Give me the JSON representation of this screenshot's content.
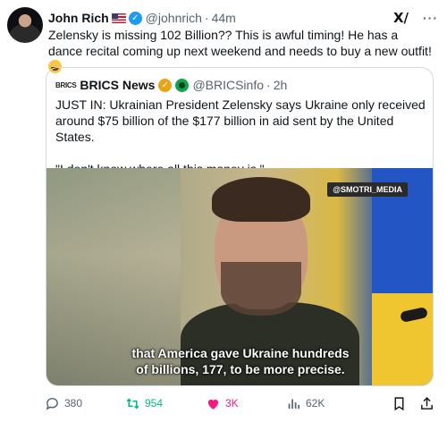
{
  "author": {
    "name": "John Rich",
    "handle": "@johnrich",
    "time": "44m",
    "separator": "·"
  },
  "header_icons": [
    "us-flag-icon",
    "verified-icon",
    "grok-icon",
    "more-icon"
  ],
  "tweet": {
    "text": "Zelensky is missing 102 Billion?? This is awful timing! He has a dance recital coming up next weekend and needs to buy a new outfit!"
  },
  "quote": {
    "logo_text": "BRICS",
    "name": "BRICS News",
    "handle": "@BRICSinfo",
    "time": "2h",
    "separator": "·",
    "paragraph_1": "JUST IN: Ukrainian President Zelensky says Ukraine only received around $75 billion of the $177 billion in aid sent by the United States.",
    "paragraph_2": "\"I don't know where all this money is.\"",
    "media": {
      "watermark": "@SMOTRI_MEDIA",
      "caption_line_1": "that America gave Ukraine hundreds",
      "caption_line_2": "of billions, 177, to be more precise."
    }
  },
  "actions": {
    "replies": "380",
    "reposts": "954",
    "likes": "3K",
    "views": "62K"
  },
  "colors": {
    "verified": "#1d9bf0",
    "repost": "#00ba7c",
    "like": "#f91880",
    "gold_badge": "#e8a317"
  }
}
